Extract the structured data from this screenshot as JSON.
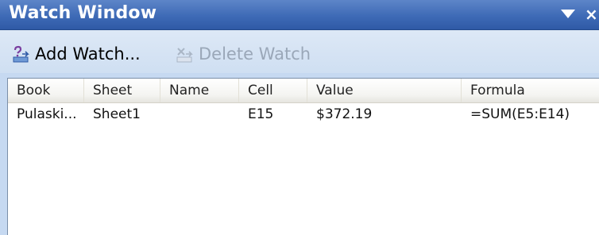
{
  "title": "Watch Window",
  "toolbar": {
    "add_label": "Add Watch...",
    "delete_label": "Delete Watch"
  },
  "columns": [
    "Book",
    "Sheet",
    "Name",
    "Cell",
    "Value",
    "Formula"
  ],
  "rows": [
    {
      "book": "Pulaski...",
      "sheet": "Sheet1",
      "name": "",
      "cell": "E15",
      "value": "$372.19",
      "formula": "=SUM(E5:E14)"
    }
  ],
  "colors": {
    "titlebar": "#3e6ab6",
    "pane_background": "#c6d9f1",
    "disabled_text": "#9aa7b8"
  }
}
